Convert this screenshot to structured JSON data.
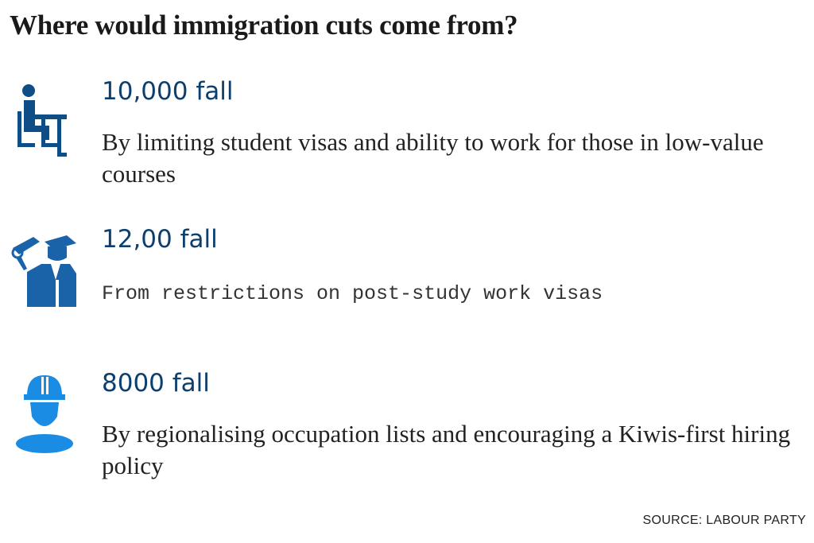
{
  "title": "Where would immigration cuts come from?",
  "items": [
    {
      "headline": "10,000 fall",
      "description": "By limiting student visas and ability to work for those in low-value courses",
      "icon": "student-at-desk-icon"
    },
    {
      "headline": "12,00 fall",
      "description": "From restrictions on post-study work visas",
      "icon": "graduate-diploma-icon"
    },
    {
      "headline": "8000 fall",
      "description": "By regionalising occupation lists and encouraging a Kiwis-first hiring policy",
      "icon": "construction-worker-icon"
    }
  ],
  "source": "SOURCE: LABOUR PARTY",
  "colors": {
    "dark_blue": "#0d3f6e",
    "icon_blue_1": "#0f4d86",
    "icon_blue_2": "#1a63a8",
    "icon_blue_3": "#1b8ce3"
  }
}
